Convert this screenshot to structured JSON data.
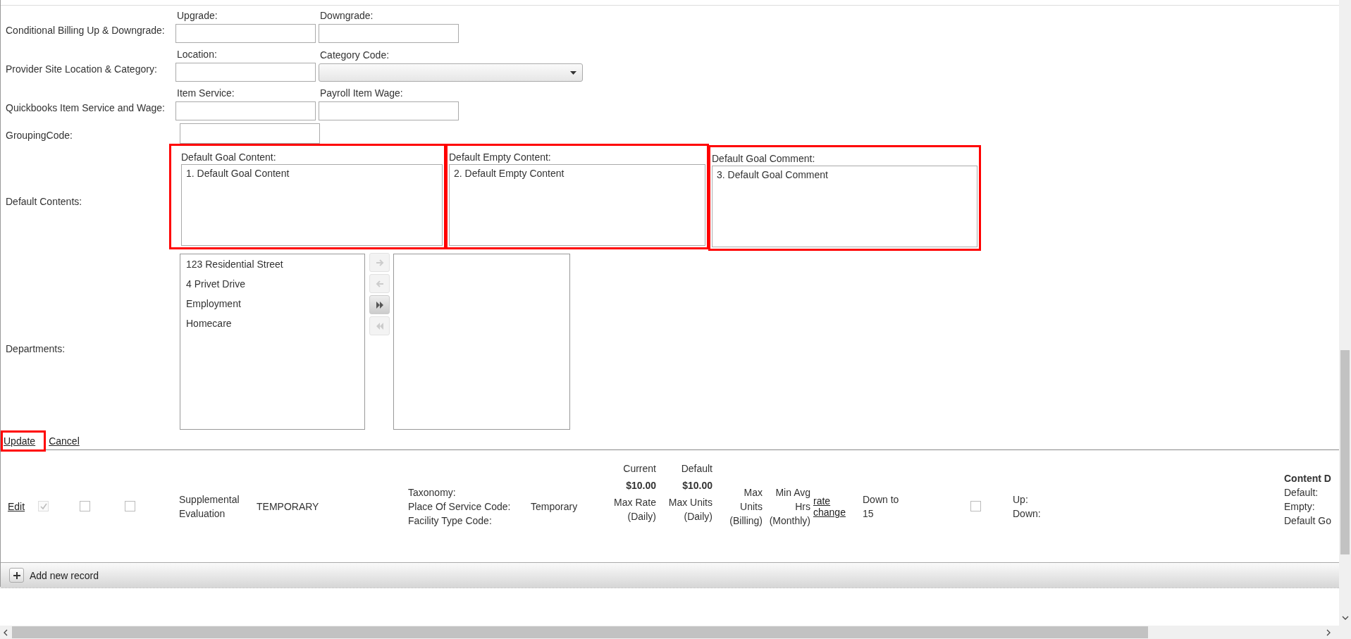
{
  "form": {
    "rows": [
      {
        "kind": "pair",
        "label": "Conditional Billing Up & Downgrade:",
        "fields": [
          {
            "kind": "text",
            "label": "Upgrade:"
          },
          {
            "kind": "text",
            "label": "Downgrade:"
          }
        ]
      },
      {
        "kind": "pair",
        "label": "Provider Site Location & Category:",
        "fields": [
          {
            "kind": "text",
            "label": "Location:"
          },
          {
            "kind": "select",
            "label": "Category Code:"
          }
        ]
      },
      {
        "kind": "pair",
        "label": "Quickbooks Item Service and Wage:",
        "fields": [
          {
            "kind": "text",
            "label": "Item Service:"
          },
          {
            "kind": "text",
            "label": "Payroll Item Wage:"
          }
        ]
      },
      {
        "kind": "single",
        "label": "GroupingCode:"
      }
    ],
    "default_contents": {
      "label": "Default Contents:",
      "boxes": [
        {
          "label": "Default Goal Content:",
          "value": "1. Default Goal Content",
          "highlighted": true
        },
        {
          "label": "Default Empty Content:",
          "value": "2. Default Empty Content",
          "highlighted": true
        },
        {
          "label": "Default Goal Comment:",
          "value": "3. Default Goal Comment",
          "highlighted": true
        }
      ]
    },
    "departments": {
      "label": "Departments:",
      "available": [
        "123 Residential Street",
        "4 Privet Drive",
        "Employment",
        "Homecare"
      ],
      "transfer_buttons": [
        {
          "kind": "move-right",
          "disabled": true
        },
        {
          "kind": "move-left",
          "disabled": true
        },
        {
          "kind": "move-all-right",
          "disabled": false
        },
        {
          "kind": "move-all-left",
          "disabled": true
        }
      ]
    },
    "actions": [
      {
        "label": "Update",
        "highlighted": true
      },
      {
        "label": "Cancel",
        "highlighted": false
      }
    ]
  },
  "grid": {
    "cells": [
      {
        "kind": "link",
        "lines": [
          "Edit"
        ]
      },
      {
        "kind": "checkbox",
        "checked": true,
        "disabled": true
      },
      {
        "kind": "checkbox",
        "checked": false
      },
      {
        "kind": "checkbox",
        "checked": false
      },
      {
        "kind": "text",
        "lines": [
          "Supplemental",
          "Evaluation"
        ]
      },
      {
        "kind": "text",
        "lines": [
          "TEMPORARY"
        ]
      },
      {
        "kind": "text",
        "lines": [
          "Taxonomy:",
          "Place Of Service Code:",
          "Facility Type Code:"
        ]
      },
      {
        "kind": "text",
        "lines": [
          "Temporary"
        ]
      },
      {
        "kind": "rate",
        "header": "Current",
        "amount": "$10.00",
        "lines": [
          "Max Rate",
          "(Daily)"
        ]
      },
      {
        "kind": "rate",
        "header": "Default",
        "amount": "$10.00",
        "lines": [
          "Max Units",
          "(Daily)"
        ]
      },
      {
        "kind": "right",
        "lines": [
          "Max",
          "Units",
          "(Billing)"
        ]
      },
      {
        "kind": "right",
        "lines": [
          "Min Avg",
          "Hrs",
          "(Monthly)"
        ]
      },
      {
        "kind": "link",
        "lines": [
          "rate",
          "change"
        ]
      },
      {
        "kind": "text",
        "lines": [
          "Down to",
          "15"
        ]
      },
      {
        "kind": "checkbox",
        "checked": false
      },
      {
        "kind": "text",
        "lines": [
          "Up:",
          "Down:"
        ]
      },
      {
        "kind": "content",
        "title": "Content D",
        "lines": [
          "Default:",
          "Empty:",
          "Default Go"
        ]
      }
    ],
    "add_new_record": "Add new record"
  }
}
